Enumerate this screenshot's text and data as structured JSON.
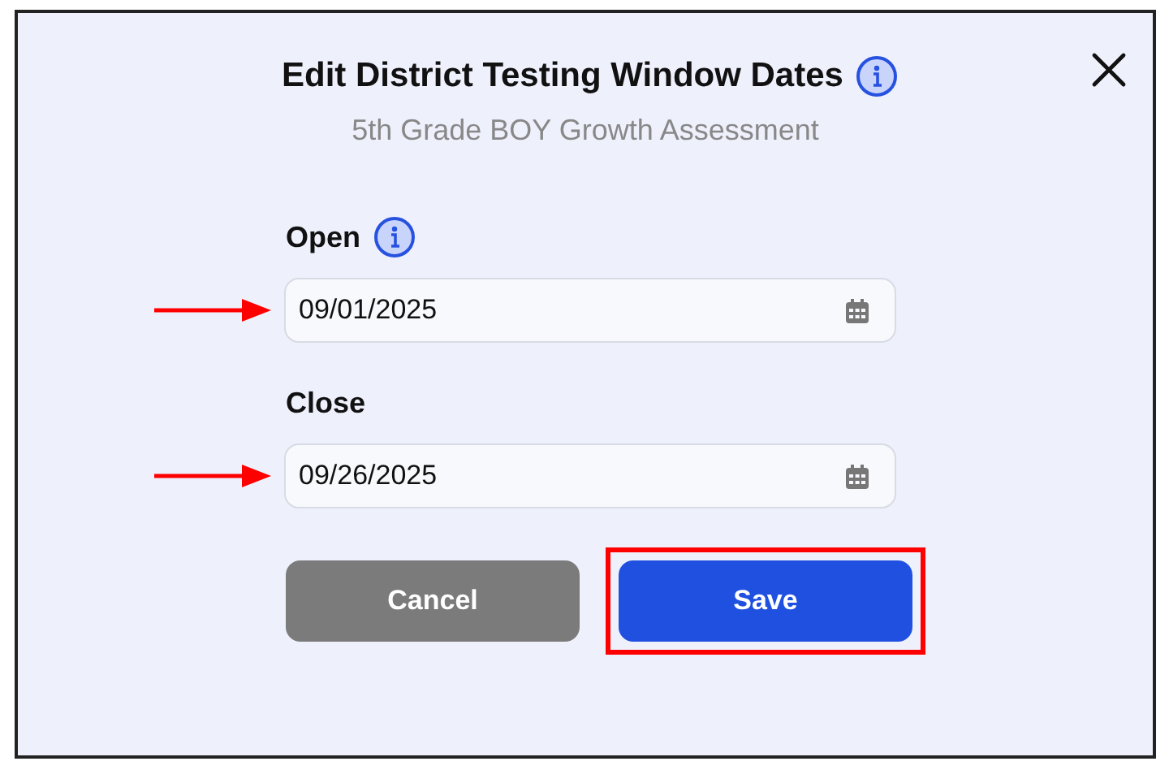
{
  "dialog": {
    "title": "Edit District Testing Window Dates",
    "title_info": true,
    "subtitle": "5th Grade BOY Growth Assessment"
  },
  "fields": [
    {
      "label": "Open",
      "info": true,
      "value": "09/01/2025",
      "arrow": true
    },
    {
      "label": "Close",
      "info": false,
      "value": "09/26/2025",
      "arrow": true
    }
  ],
  "buttons": [
    {
      "label": "Cancel",
      "kind": "secondary",
      "highlighted": false
    },
    {
      "label": "Save",
      "kind": "primary",
      "highlighted": true
    }
  ]
}
